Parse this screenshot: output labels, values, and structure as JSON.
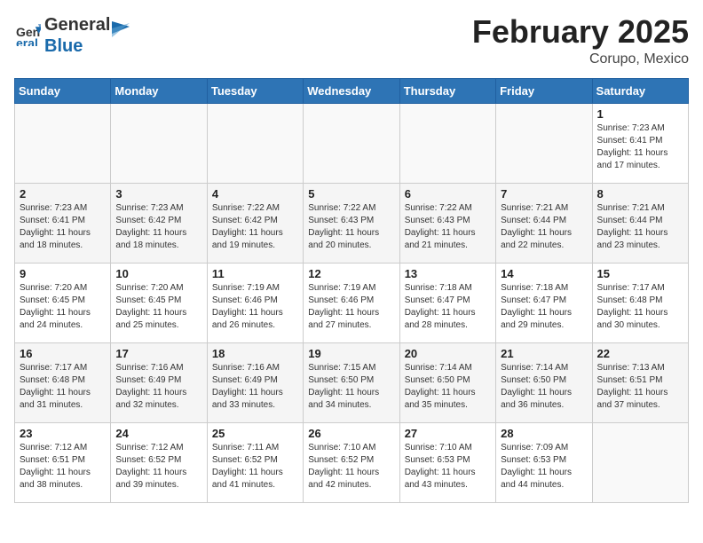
{
  "logo": {
    "general": "General",
    "blue": "Blue"
  },
  "header": {
    "month_year": "February 2025",
    "location": "Corupo, Mexico"
  },
  "weekdays": [
    "Sunday",
    "Monday",
    "Tuesday",
    "Wednesday",
    "Thursday",
    "Friday",
    "Saturday"
  ],
  "weeks": [
    [
      {
        "day": "",
        "sunrise": "",
        "sunset": "",
        "daylight": ""
      },
      {
        "day": "",
        "sunrise": "",
        "sunset": "",
        "daylight": ""
      },
      {
        "day": "",
        "sunrise": "",
        "sunset": "",
        "daylight": ""
      },
      {
        "day": "",
        "sunrise": "",
        "sunset": "",
        "daylight": ""
      },
      {
        "day": "",
        "sunrise": "",
        "sunset": "",
        "daylight": ""
      },
      {
        "day": "",
        "sunrise": "",
        "sunset": "",
        "daylight": ""
      },
      {
        "day": "1",
        "sunrise": "7:23 AM",
        "sunset": "6:41 PM",
        "daylight": "11 hours and 17 minutes."
      }
    ],
    [
      {
        "day": "2",
        "sunrise": "7:23 AM",
        "sunset": "6:41 PM",
        "daylight": "11 hours and 18 minutes."
      },
      {
        "day": "3",
        "sunrise": "7:23 AM",
        "sunset": "6:42 PM",
        "daylight": "11 hours and 18 minutes."
      },
      {
        "day": "4",
        "sunrise": "7:22 AM",
        "sunset": "6:42 PM",
        "daylight": "11 hours and 19 minutes."
      },
      {
        "day": "5",
        "sunrise": "7:22 AM",
        "sunset": "6:43 PM",
        "daylight": "11 hours and 20 minutes."
      },
      {
        "day": "6",
        "sunrise": "7:22 AM",
        "sunset": "6:43 PM",
        "daylight": "11 hours and 21 minutes."
      },
      {
        "day": "7",
        "sunrise": "7:21 AM",
        "sunset": "6:44 PM",
        "daylight": "11 hours and 22 minutes."
      },
      {
        "day": "8",
        "sunrise": "7:21 AM",
        "sunset": "6:44 PM",
        "daylight": "11 hours and 23 minutes."
      }
    ],
    [
      {
        "day": "9",
        "sunrise": "7:20 AM",
        "sunset": "6:45 PM",
        "daylight": "11 hours and 24 minutes."
      },
      {
        "day": "10",
        "sunrise": "7:20 AM",
        "sunset": "6:45 PM",
        "daylight": "11 hours and 25 minutes."
      },
      {
        "day": "11",
        "sunrise": "7:19 AM",
        "sunset": "6:46 PM",
        "daylight": "11 hours and 26 minutes."
      },
      {
        "day": "12",
        "sunrise": "7:19 AM",
        "sunset": "6:46 PM",
        "daylight": "11 hours and 27 minutes."
      },
      {
        "day": "13",
        "sunrise": "7:18 AM",
        "sunset": "6:47 PM",
        "daylight": "11 hours and 28 minutes."
      },
      {
        "day": "14",
        "sunrise": "7:18 AM",
        "sunset": "6:47 PM",
        "daylight": "11 hours and 29 minutes."
      },
      {
        "day": "15",
        "sunrise": "7:17 AM",
        "sunset": "6:48 PM",
        "daylight": "11 hours and 30 minutes."
      }
    ],
    [
      {
        "day": "16",
        "sunrise": "7:17 AM",
        "sunset": "6:48 PM",
        "daylight": "11 hours and 31 minutes."
      },
      {
        "day": "17",
        "sunrise": "7:16 AM",
        "sunset": "6:49 PM",
        "daylight": "11 hours and 32 minutes."
      },
      {
        "day": "18",
        "sunrise": "7:16 AM",
        "sunset": "6:49 PM",
        "daylight": "11 hours and 33 minutes."
      },
      {
        "day": "19",
        "sunrise": "7:15 AM",
        "sunset": "6:50 PM",
        "daylight": "11 hours and 34 minutes."
      },
      {
        "day": "20",
        "sunrise": "7:14 AM",
        "sunset": "6:50 PM",
        "daylight": "11 hours and 35 minutes."
      },
      {
        "day": "21",
        "sunrise": "7:14 AM",
        "sunset": "6:50 PM",
        "daylight": "11 hours and 36 minutes."
      },
      {
        "day": "22",
        "sunrise": "7:13 AM",
        "sunset": "6:51 PM",
        "daylight": "11 hours and 37 minutes."
      }
    ],
    [
      {
        "day": "23",
        "sunrise": "7:12 AM",
        "sunset": "6:51 PM",
        "daylight": "11 hours and 38 minutes."
      },
      {
        "day": "24",
        "sunrise": "7:12 AM",
        "sunset": "6:52 PM",
        "daylight": "11 hours and 39 minutes."
      },
      {
        "day": "25",
        "sunrise": "7:11 AM",
        "sunset": "6:52 PM",
        "daylight": "11 hours and 41 minutes."
      },
      {
        "day": "26",
        "sunrise": "7:10 AM",
        "sunset": "6:52 PM",
        "daylight": "11 hours and 42 minutes."
      },
      {
        "day": "27",
        "sunrise": "7:10 AM",
        "sunset": "6:53 PM",
        "daylight": "11 hours and 43 minutes."
      },
      {
        "day": "28",
        "sunrise": "7:09 AM",
        "sunset": "6:53 PM",
        "daylight": "11 hours and 44 minutes."
      },
      {
        "day": "",
        "sunrise": "",
        "sunset": "",
        "daylight": ""
      }
    ]
  ]
}
